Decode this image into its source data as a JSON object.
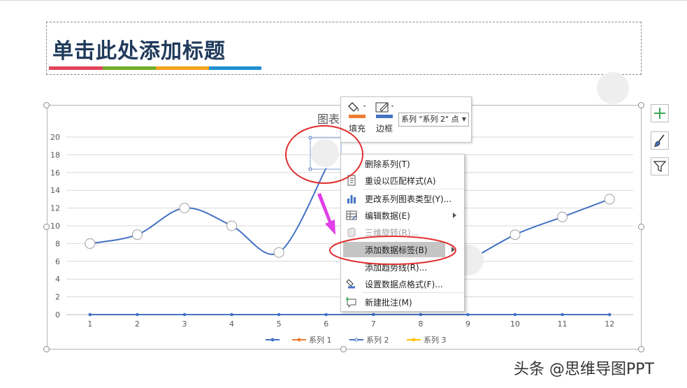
{
  "slide": {
    "title": "单击此处添加标题",
    "title_bar_colors": [
      "#e0455a",
      "#70ad2a",
      "#f5a21b",
      "#1e8fd0"
    ]
  },
  "chart_data": {
    "type": "line",
    "title": "图表",
    "x": [
      1,
      2,
      3,
      4,
      5,
      6,
      7,
      8,
      9,
      10,
      11,
      12
    ],
    "ylim": [
      0,
      20
    ],
    "yticks": [
      0,
      2,
      4,
      6,
      8,
      10,
      12,
      14,
      16,
      18,
      20
    ],
    "grid": true,
    "legend_position": "bottom",
    "series": [
      {
        "name": "",
        "color": "#4472c4",
        "values": [
          0,
          0,
          0,
          0,
          0,
          0,
          0,
          0,
          0,
          0,
          0,
          0
        ]
      },
      {
        "name": "系列 1",
        "color": "#ed7d31",
        "values": []
      },
      {
        "name": "系列 2",
        "color": "#4472c4",
        "values": [
          8,
          9,
          12,
          10,
          7,
          16.5,
          null,
          null,
          6,
          9,
          11,
          13
        ]
      },
      {
        "name": "系列 3",
        "color": "#ffc000",
        "values": []
      }
    ]
  },
  "format_toolbar": {
    "fill_label": "填充",
    "border_label": "边框",
    "series_select": "系列 \"系列 2\" 点",
    "fill_color": "#ed7d31",
    "border_color": "#4472c4"
  },
  "context_menu": {
    "items": [
      {
        "label": "删除系列(T)",
        "icon": "delete-series-icon"
      },
      {
        "label": "重设以匹配样式(A)",
        "icon": "reset-style-icon"
      },
      {
        "label": "更改系列图表类型(Y)...",
        "icon": "chart-type-icon"
      },
      {
        "label": "编辑数据(E)",
        "icon": "edit-data-icon"
      },
      {
        "label": "三维旋转(R)...",
        "icon": "3d-rotation-icon"
      },
      {
        "label": "添加数据标签(B)",
        "icon": ""
      },
      {
        "label": "添加趋势线(R)...",
        "icon": ""
      },
      {
        "label": "设置数据点格式(F)...",
        "icon": "format-point-icon"
      },
      {
        "label": "新建批注(M)",
        "icon": "new-comment-icon"
      }
    ]
  },
  "side_buttons": [
    "chart-elements-icon",
    "chart-styles-icon",
    "chart-filter-icon"
  ],
  "watermark": "头条 @思维导图PPT",
  "annotation_colors": {
    "circle": "#e03030",
    "arrow": "#e040e8"
  }
}
